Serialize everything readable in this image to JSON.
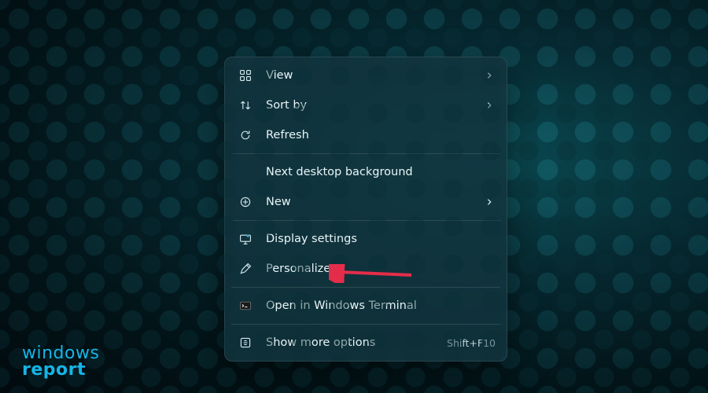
{
  "menu": {
    "group1": [
      {
        "label": "View",
        "submenu": true,
        "icon": "view"
      },
      {
        "label": "Sort by",
        "submenu": true,
        "icon": "sort"
      },
      {
        "label": "Refresh",
        "submenu": false,
        "icon": "refresh"
      }
    ],
    "group2": [
      {
        "label": "Next desktop background",
        "submenu": false,
        "icon": ""
      },
      {
        "label": "New",
        "submenu": true,
        "icon": "new"
      }
    ],
    "group3": [
      {
        "label": "Display settings",
        "submenu": false,
        "icon": "display"
      },
      {
        "label": "Personalize",
        "submenu": false,
        "icon": "personalize"
      }
    ],
    "group4": [
      {
        "label": "Open in Windows Terminal",
        "submenu": false,
        "icon": "terminal"
      }
    ],
    "group5": [
      {
        "label": "Show more options",
        "submenu": false,
        "icon": "more",
        "shortcut": "Shift+F10"
      }
    ]
  },
  "annotations": {
    "arrow_color": "#e42d4a"
  },
  "logo": {
    "line1": "windows",
    "line2": "report"
  }
}
